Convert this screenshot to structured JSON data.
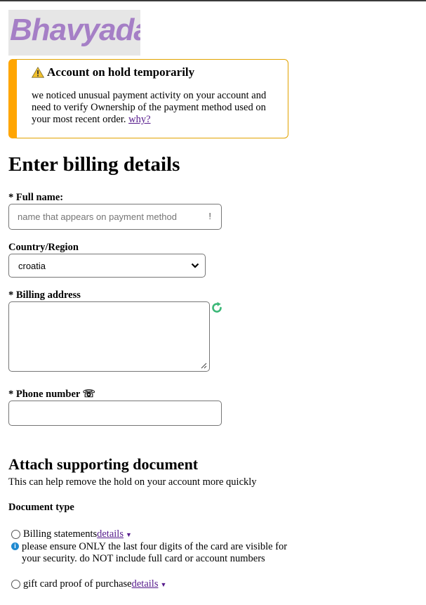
{
  "logo": {
    "text": "Bhavyadaan"
  },
  "alert": {
    "title": "Account on hold temporarily",
    "body": "we noticed unusual payment activity on your account and need to verify Ownership of the payment method used on your most recent order. ",
    "link": "why?",
    "icon": "warning-icon",
    "accent": "#ffa500"
  },
  "page_title": "Enter billing details",
  "fields": {
    "full_name": {
      "label": "* Full name:",
      "placeholder": "name that appears on payment method",
      "hint": "!"
    },
    "country": {
      "label": "Country/Region",
      "value": "croatia"
    },
    "billing_address": {
      "label": "* Billing address"
    },
    "phone": {
      "label": "* Phone number ☏"
    }
  },
  "attach": {
    "title": "Attach supporting document",
    "subtitle": "This can help remove the hold on your account more quickly",
    "doc_type_label": "Document type",
    "options": [
      {
        "label": "Billing statements ",
        "link": "details"
      },
      {
        "label": "gift card proof of purchase",
        "link": "details"
      }
    ],
    "note": "please ensure ONLY the last four digits of the card are visible for your security. do NOT include full card or account numbers",
    "info_icon": "i"
  }
}
